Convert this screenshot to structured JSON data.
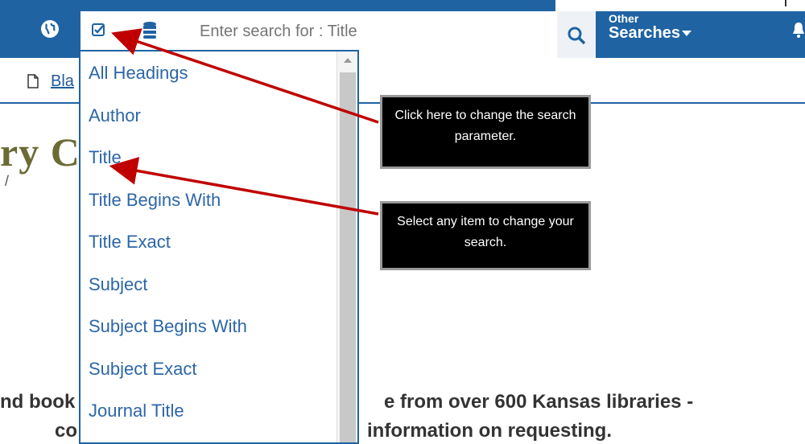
{
  "header": {
    "search_placeholder": "Enter search for : Title",
    "other_searches_line1": "Other",
    "other_searches_line2": "Searches"
  },
  "subbar": {
    "link_fragment": "Bla"
  },
  "page": {
    "heading_fragment": "ry C",
    "slash_fragment": "/",
    "body_line1_left": "nd book",
    "body_line1_right": "e from over 600 Kansas libraries -",
    "body_line2_left": "co",
    "body_line2_right": "information on requesting."
  },
  "dropdown": {
    "items": [
      "All Headings",
      "Author",
      "Title",
      "Title Begins With",
      "Title Exact",
      "Subject",
      "Subject Begins With",
      "Subject Exact",
      "Journal Title"
    ]
  },
  "callouts": {
    "first": "Click here to change the search parameter.",
    "second": "Select any item to change your search."
  },
  "colors": {
    "header_blue": "#1f63a3",
    "link_blue": "#2c66a8",
    "arrow_red": "#c00000"
  }
}
